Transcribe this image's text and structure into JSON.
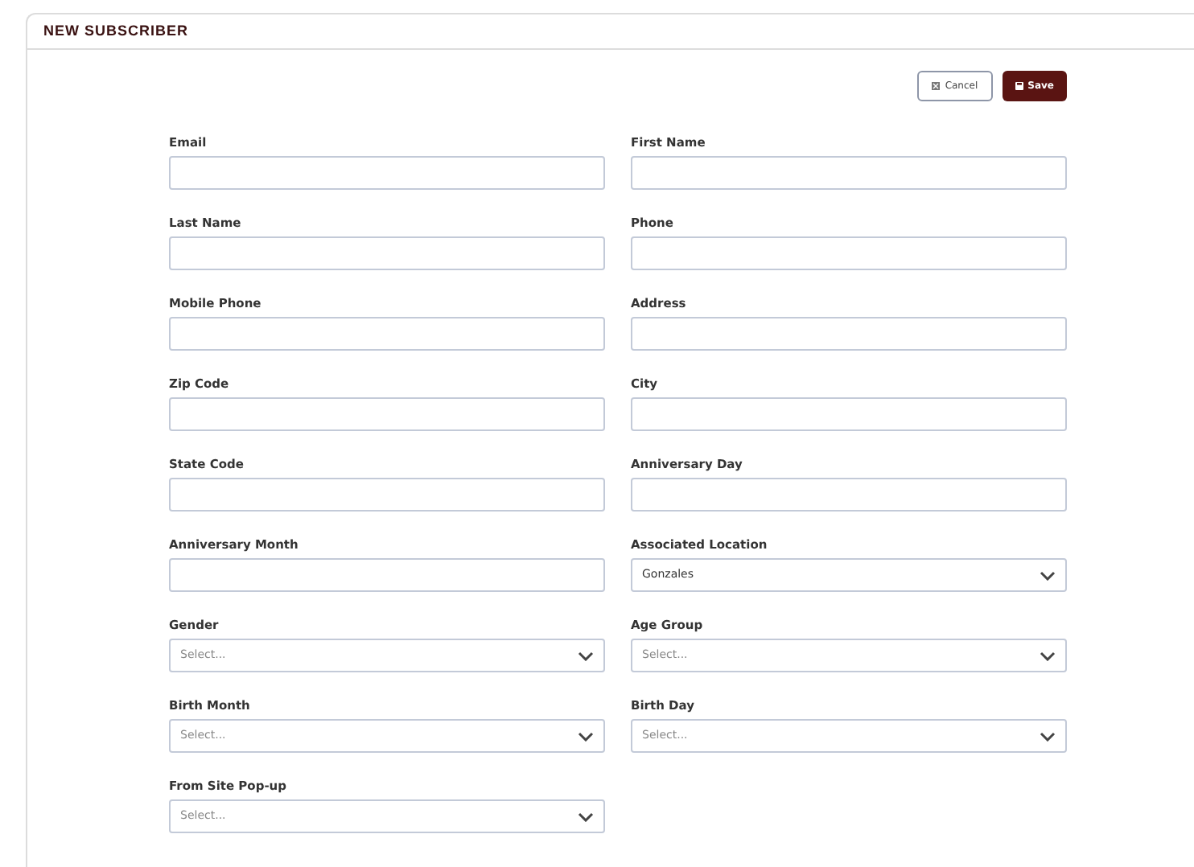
{
  "title": "NEW SUBSCRIBER",
  "buttons": [
    {
      "kind": "cancel",
      "label": "Cancel"
    },
    {
      "kind": "save",
      "label": "Save"
    }
  ],
  "fields": [
    {
      "label": "Email",
      "kind": "text"
    },
    {
      "label": "First Name",
      "kind": "text"
    },
    {
      "label": "Last Name",
      "kind": "text"
    },
    {
      "label": "Phone",
      "kind": "text"
    },
    {
      "label": "Mobile Phone",
      "kind": "text"
    },
    {
      "label": "Address",
      "kind": "text"
    },
    {
      "label": "Zip Code",
      "kind": "text"
    },
    {
      "label": "City",
      "kind": "text"
    },
    {
      "label": "State Code",
      "kind": "text"
    },
    {
      "label": "Anniversary Day",
      "kind": "text"
    },
    {
      "label": "Anniversary Month",
      "kind": "text"
    },
    {
      "label": "Associated Location",
      "kind": "select",
      "value": "Gonzales"
    },
    {
      "label": "Gender",
      "kind": "select",
      "placeholder": "Select..."
    },
    {
      "label": "Age Group",
      "kind": "select",
      "placeholder": "Select..."
    },
    {
      "label": "Birth Month",
      "kind": "select",
      "placeholder": "Select..."
    },
    {
      "label": "Birth Day",
      "kind": "select",
      "placeholder": "Select..."
    },
    {
      "label": "From Site Pop-up",
      "kind": "select",
      "placeholder": "Select..."
    }
  ]
}
